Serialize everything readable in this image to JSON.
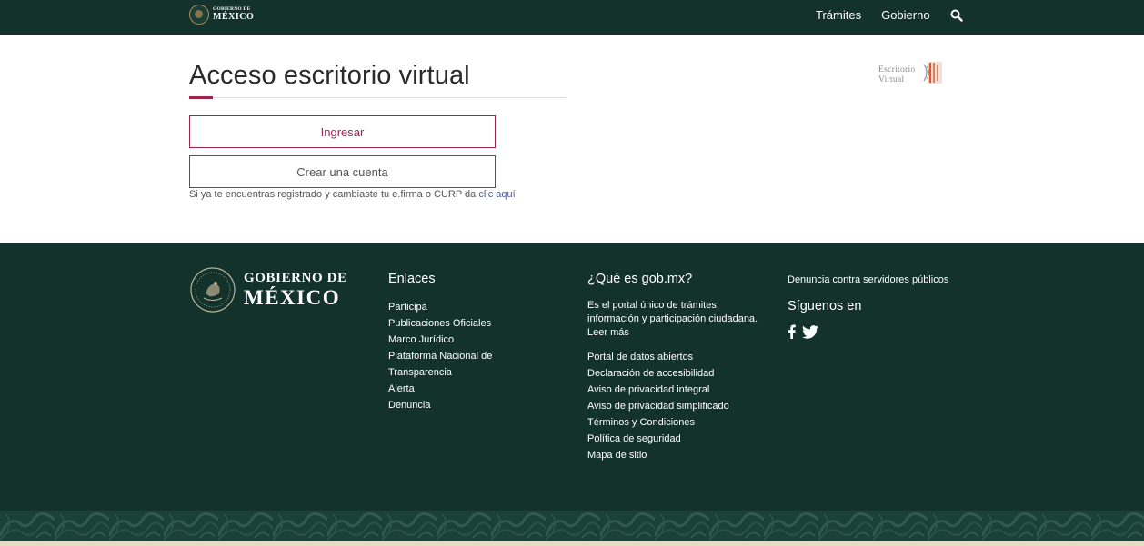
{
  "navbar": {
    "logo_line1": "GOBIERNO DE",
    "logo_line2": "MÉXICO",
    "links": [
      "Trámites",
      "Gobierno"
    ],
    "search_icon": "search-icon",
    "bg_color": "#13322b"
  },
  "main": {
    "title": "Acceso escritorio virtual",
    "accent_color": "#9d2449",
    "ingresar_label": "Ingresar",
    "crear_label": "Crear una cuenta",
    "help_text": "Si ya te encuentras registrado y cambiaste tu e.firma o CURP da",
    "help_link": "clic aquí",
    "ev_logo_line1": "Escritorio",
    "ev_logo_line2": "Virtual"
  },
  "footer": {
    "logo_line1": "GOBIERNO DE",
    "logo_line2": "MÉXICO",
    "enlaces": {
      "heading": "Enlaces",
      "items": [
        "Participa",
        "Publicaciones Oficiales",
        "Marco Jurídico",
        "Plataforma Nacional de",
        "Transparencia",
        "Alerta",
        "Denuncia"
      ]
    },
    "que_es": {
      "heading": "¿Qué es gob.mx?",
      "description": "Es el portal único de trámites, información y participación ciudadana.",
      "leer_mas": "Leer más",
      "items": [
        "Portal de datos abiertos",
        "Declaración de accesibilidad",
        "Aviso de privacidad integral",
        "Aviso de privacidad simplificado",
        "Términos y Condiciones",
        "Política de seguridad",
        "Mapa de sitio"
      ]
    },
    "right": {
      "denuncia": "Denuncia contra servidores públicos",
      "siguenos": "Síguenos en",
      "social_icons": [
        "facebook-icon",
        "twitter-icon"
      ]
    },
    "bg_color": "#13322b"
  }
}
